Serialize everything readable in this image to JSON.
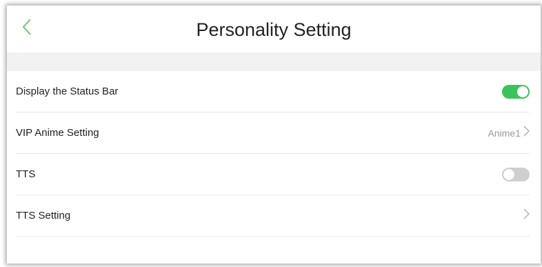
{
  "header": {
    "title": "Personality Setting",
    "back_icon": "chevron-left-icon",
    "back_color": "#6cc06b"
  },
  "settings": [
    {
      "label": "Display the Status Bar",
      "control": "toggle",
      "on": true
    },
    {
      "label": "VIP Anime Setting",
      "control": "link",
      "value": "Anime1"
    },
    {
      "label": "TTS",
      "control": "toggle",
      "on": false
    },
    {
      "label": "TTS Setting",
      "control": "link",
      "value": ""
    }
  ],
  "colors": {
    "accent": "#3cc25a",
    "toggle_off": "#cfcfcf"
  }
}
